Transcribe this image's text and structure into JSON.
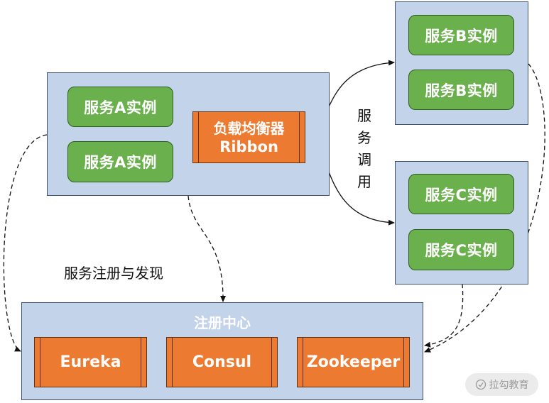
{
  "service_a": {
    "instances": [
      "服务A实例",
      "服务A实例"
    ]
  },
  "load_balancer": {
    "line1": "负载均衡器",
    "line2": "Ribbon"
  },
  "service_b": {
    "instances": [
      "服务B实例",
      "服务B实例"
    ]
  },
  "service_c": {
    "instances": [
      "服务C实例",
      "服务C实例"
    ]
  },
  "call_label": "服务调用",
  "registration_label": "服务注册与发现",
  "registry": {
    "title": "注册中心",
    "items": [
      "Eureka",
      "Consul",
      "Zookeeper"
    ]
  },
  "watermark": {
    "icon": "lagou-logo-icon",
    "text": "拉勾教育"
  },
  "colors": {
    "panel": "#c3d3e9",
    "service": "#6ab04c",
    "component": "#ec7a31"
  }
}
